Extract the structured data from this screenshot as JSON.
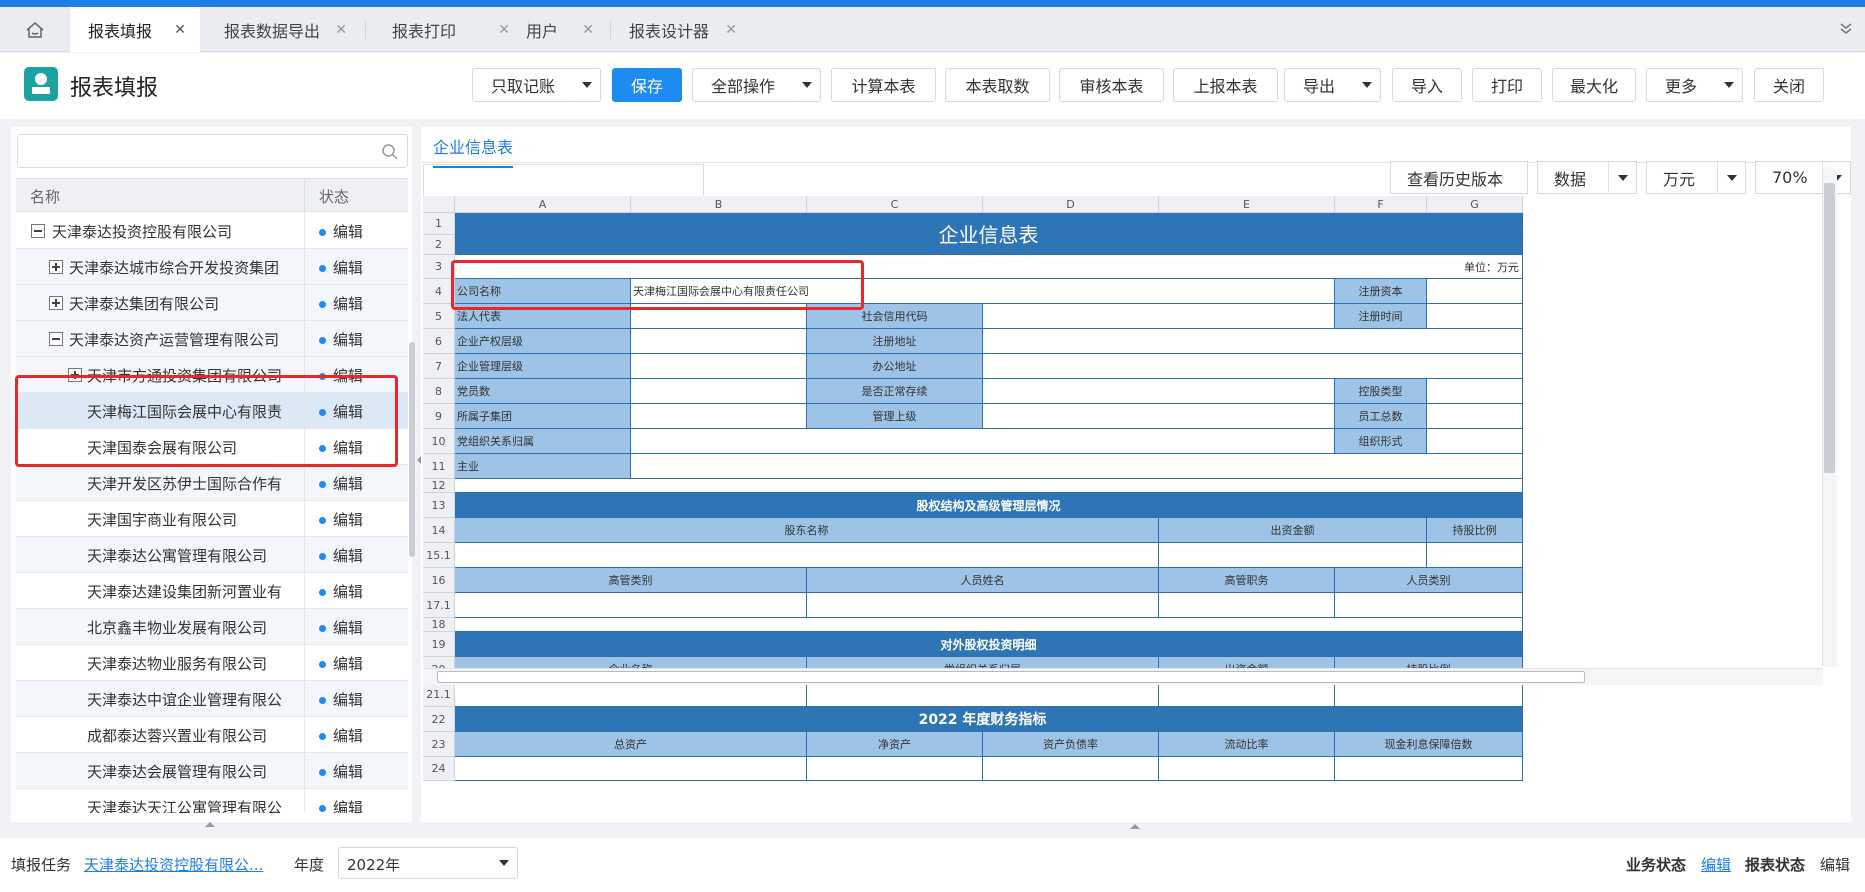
{
  "tabs": [
    {
      "label": "报表填报",
      "active": true
    },
    {
      "label": "报表数据导出",
      "active": false
    },
    {
      "label": "报表打印",
      "active": false
    },
    {
      "label": "用户",
      "active": false
    },
    {
      "label": "报表设计器",
      "active": false
    }
  ],
  "icons": {
    "home": "home-icon",
    "close": "close-icon",
    "collapse": "double-chevron-down-icon",
    "search": "search-icon",
    "logo": "report-app-icon"
  },
  "toolbar": {
    "title": "报表填报",
    "only_record": "只取记账",
    "save": "保存",
    "all_ops": "全部操作",
    "calc": "计算本表",
    "fetch": "本表取数",
    "audit": "审核本表",
    "submit": "上报本表",
    "export": "导出",
    "import": "导入",
    "print": "打印",
    "maximize": "最大化",
    "more": "更多",
    "close": "关闭"
  },
  "tree": {
    "search_placeholder": "",
    "col_name": "名称",
    "col_status": "状态",
    "rows": [
      {
        "name": "天津泰达投资控股有限公司",
        "status": "编辑"
      },
      {
        "name": "天津泰达城市综合开发投资集团",
        "status": "编辑"
      },
      {
        "name": "天津泰达集团有限公司",
        "status": "编辑"
      },
      {
        "name": "天津泰达资产运营管理有限公司",
        "status": "编辑"
      },
      {
        "name": "天津市方通投资集团有限公司",
        "status": "编辑"
      },
      {
        "name": "天津梅江国际会展中心有限责",
        "status": "编辑"
      },
      {
        "name": "天津国泰会展有限公司",
        "status": "编辑"
      },
      {
        "name": "天津开发区苏伊士国际合作有",
        "status": "编辑"
      },
      {
        "name": "天津国宇商业有限公司",
        "status": "编辑"
      },
      {
        "name": "天津泰达公寓管理有限公司",
        "status": "编辑"
      },
      {
        "name": "天津泰达建设集团新河置业有",
        "status": "编辑"
      },
      {
        "name": "北京鑫丰物业发展有限公司",
        "status": "编辑"
      },
      {
        "name": "天津泰达物业服务有限公司",
        "status": "编辑"
      },
      {
        "name": "天津泰达中谊企业管理有限公",
        "status": "编辑"
      },
      {
        "name": "成都泰达蓉兴置业有限公司",
        "status": "编辑"
      },
      {
        "name": "天津泰达会展管理有限公司",
        "status": "编辑"
      },
      {
        "name": "天津泰达天江公寓管理有限公",
        "status": "编辑"
      }
    ]
  },
  "sheet": {
    "tab": "企业信息表",
    "history_btn": "查看历史版本",
    "data_select": "数据",
    "unit_select": "万元",
    "zoom": "70%",
    "columns": [
      "A",
      "B",
      "C",
      "D",
      "E",
      "F",
      "G"
    ],
    "row_labels": [
      "1",
      "2",
      "3",
      "4",
      "5",
      "6",
      "7",
      "8",
      "9",
      "10",
      "11",
      "12",
      "13",
      "14",
      "15.1",
      "16",
      "17.1",
      "18",
      "19",
      "20",
      "21.1",
      "22",
      "23",
      "24"
    ],
    "title": "企业信息表",
    "unit_note": "单位：万元",
    "labels": {
      "company_name": "公司名称",
      "company_name_value": "天津梅江国际会展中心有限责任公司",
      "reg_capital": "注册资本",
      "legal_rep": "法人代表",
      "credit_code": "社会信用代码",
      "reg_time": "注册时间",
      "property_level": "企业产权层级",
      "reg_address": "注册地址",
      "mgmt_level": "企业管理层级",
      "office_address": "办公地址",
      "party_count": "党员数",
      "normal_operation": "是否正常存续",
      "holding_type": "控股类型",
      "subgroup": "所属子集团",
      "superior": "管理上级",
      "staff_total": "员工总数",
      "party_org": "党组织关系归属",
      "org_form": "组织形式",
      "main_business": "主业"
    },
    "sec_equity": "股权结构及高级管理层情况",
    "equity_headers": [
      "股东名称",
      "出资金额",
      "持股比例"
    ],
    "mgmt_headers": [
      "高管类别",
      "人员姓名",
      "高管职务",
      "人员类别"
    ],
    "sec_invest": "对外股权投资明细",
    "invest_headers": [
      "企业名称",
      "党组织关系归属",
      "出资金额",
      "持股比例"
    ],
    "sec_finance": "2022 年度财务指标",
    "finance_headers": [
      "总资产",
      "净资产",
      "资产负债率",
      "流动比率",
      "现金利息保障倍数"
    ]
  },
  "footer": {
    "task_label": "填报任务",
    "task_value": "天津泰达投资控股有限公...",
    "year_label": "年度",
    "year_value": "2022年",
    "biz_status_label": "业务状态",
    "biz_status_value": "编辑",
    "report_status_label": "报表状态",
    "report_status_value": "编辑"
  },
  "colors": {
    "accent": "#1d8cf0",
    "band": "#2e75b6",
    "label_cell": "#9dc3e6",
    "highlight": "#e8282d"
  }
}
